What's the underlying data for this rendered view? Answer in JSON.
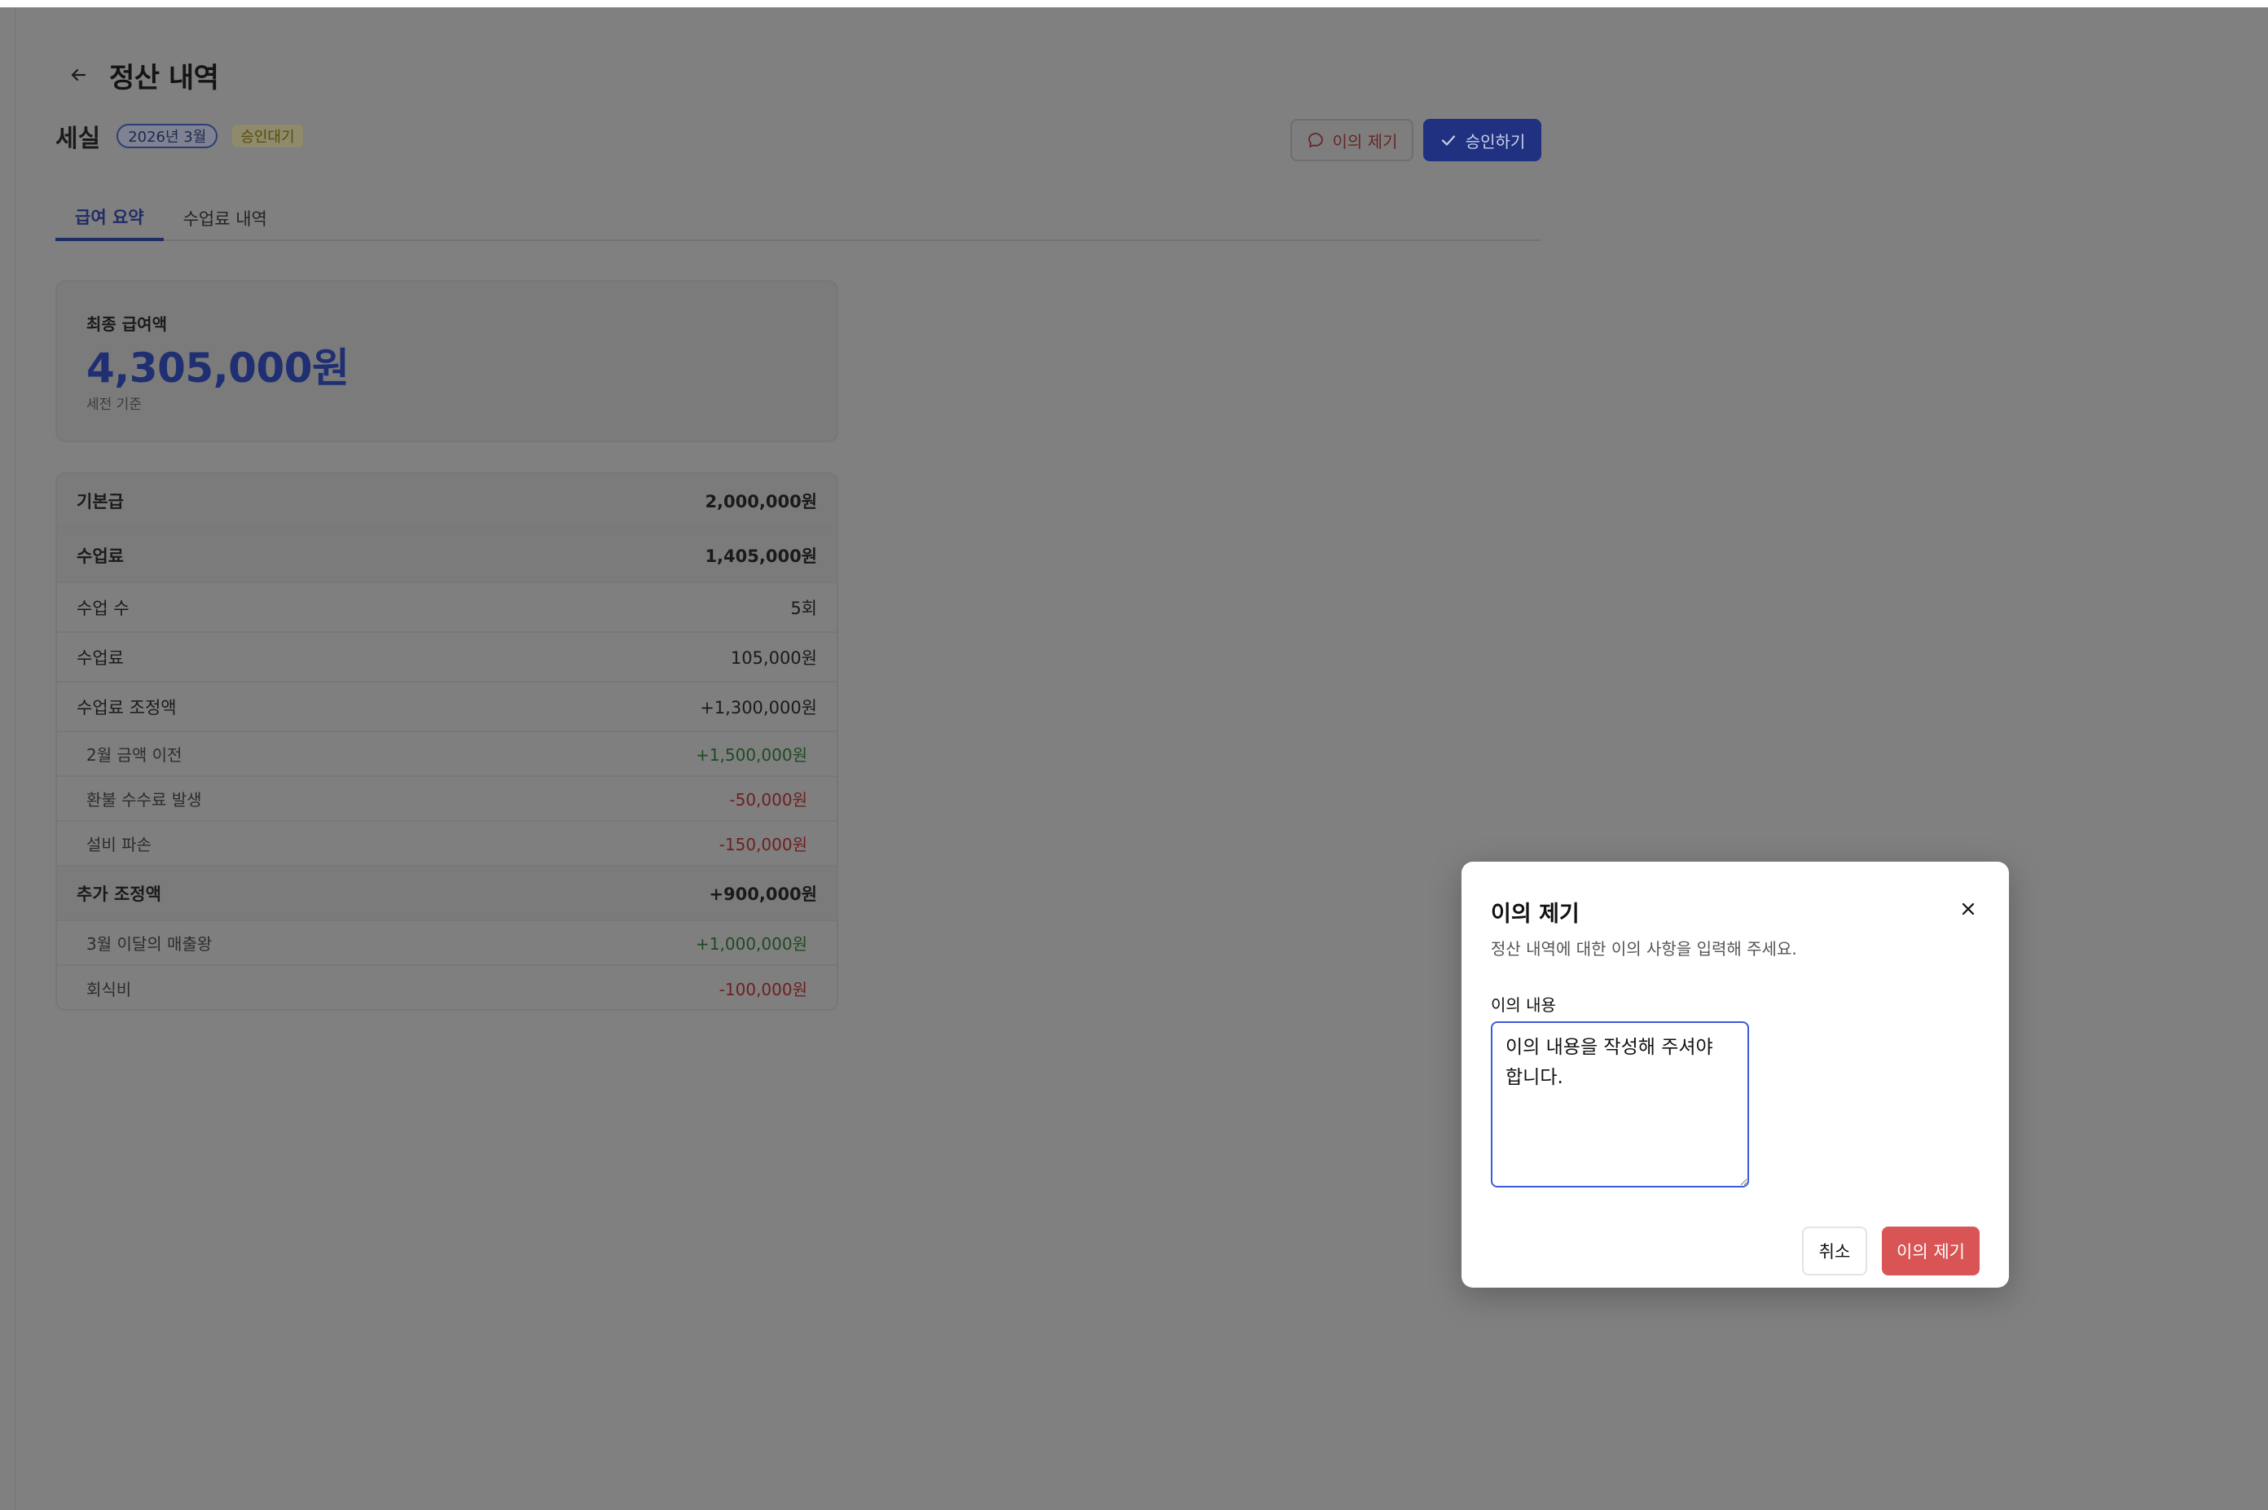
{
  "header": {
    "title": "정산 내역",
    "back_icon": "arrow-left-icon"
  },
  "sub_header": {
    "name": "세실",
    "month_badge": "2026년 3월",
    "status_badge": "승인대기",
    "objection_label": "이의 제기",
    "approve_label": "승인하기"
  },
  "tabs": [
    {
      "label": "급여 요약",
      "active": true
    },
    {
      "label": "수업료 내역",
      "active": false
    }
  ],
  "summary": {
    "label": "최종 급여액",
    "amount": "4,305,000원",
    "note": "세전 기준"
  },
  "breakdown": {
    "base_pay": {
      "label": "기본급",
      "value": "2,000,000원"
    },
    "tuition": {
      "label": "수업료",
      "value": "1,405,000원"
    },
    "class_count": {
      "label": "수업 수",
      "value": "5회"
    },
    "tuition_fee": {
      "label": "수업료",
      "value": "105,000원"
    },
    "tuition_adjust": {
      "label": "수업료 조정액",
      "value": "+1,300,000원"
    },
    "tuition_adjust_items": [
      {
        "label": "2월 금액 이전",
        "value": "+1,500,000원"
      },
      {
        "label": "환불 수수료 발생",
        "value": "-50,000원"
      },
      {
        "label": "설비 파손",
        "value": "-150,000원"
      }
    ],
    "extra_adjust": {
      "label": "추가 조정액",
      "value": "+900,000원"
    },
    "extra_adjust_items": [
      {
        "label": "3월 이달의 매출왕",
        "value": "+1,000,000원"
      },
      {
        "label": "회식비",
        "value": "-100,000원"
      }
    ]
  },
  "modal": {
    "title": "이의 제기",
    "description": "정산 내역에 대한 이의 사항을 입력해 주세요.",
    "field_label": "이의 내용",
    "textarea_value": "이의 내용을 작성해 주셔야 합니다.",
    "cancel_label": "취소",
    "submit_label": "이의 제기"
  },
  "colors": {
    "accent": "#1f3180",
    "danger": "#d95454",
    "positive": "#1e4a22",
    "negative": "#6e1f1f"
  }
}
